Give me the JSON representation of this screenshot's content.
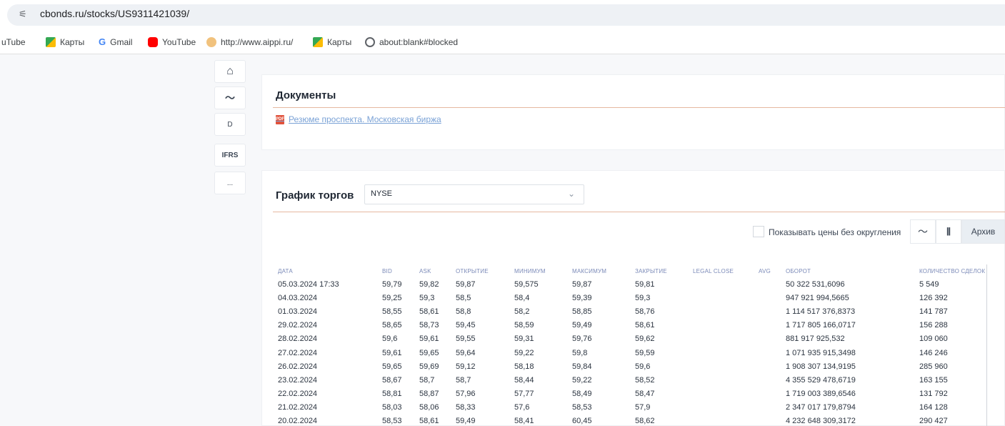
{
  "browser": {
    "url": "cbonds.ru/stocks/US9311421039/",
    "bookmarks": [
      "uTube",
      "Карты",
      "Gmail",
      "YouTube",
      "http://www.aippi.ru/",
      "Карты",
      "about:blank#blocked"
    ]
  },
  "sidebar": {
    "items": [
      "⌂",
      "〜",
      "D",
      "IFRS",
      "..."
    ]
  },
  "documents": {
    "title": "Документы",
    "link": "Резюме проспекта. Московская биржа",
    "pdf_badge": "PDF"
  },
  "trading": {
    "title": "График торгов",
    "exchange": "NYSE",
    "chevron": "⌄",
    "raw_prices_label": "Показывать цены без округления",
    "archive_label": "Архив"
  },
  "table": {
    "headers": [
      "ДАТА",
      "BID",
      "ASK",
      "ОТКРЫТИЕ",
      "МИНИМУМ",
      "МАКСИМУМ",
      "ЗАКРЫТИЕ",
      "LEGAL CLOSE",
      "AVG",
      "ОБОРОТ",
      "КОЛИЧЕСТВО СДЕЛОК"
    ],
    "rows": [
      [
        "05.03.2024 17:33",
        "59,79",
        "59,82",
        "59,87",
        "59,575",
        "59,87",
        "59,81",
        "",
        "",
        "50 322 531,6096",
        "5 549"
      ],
      [
        "04.03.2024",
        "59,25",
        "59,3",
        "58,5",
        "58,4",
        "59,39",
        "59,3",
        "",
        "",
        "947 921 994,5665",
        "126 392"
      ],
      [
        "01.03.2024",
        "58,55",
        "58,61",
        "58,8",
        "58,2",
        "58,85",
        "58,76",
        "",
        "",
        "1 114 517 376,8373",
        "141 787"
      ],
      [
        "29.02.2024",
        "58,65",
        "58,73",
        "59,45",
        "58,59",
        "59,49",
        "58,61",
        "",
        "",
        "1 717 805 166,0717",
        "156 288"
      ],
      [
        "28.02.2024",
        "59,6",
        "59,61",
        "59,55",
        "59,31",
        "59,76",
        "59,62",
        "",
        "",
        "881 917 925,532",
        "109 060"
      ],
      [
        "27.02.2024",
        "59,61",
        "59,65",
        "59,64",
        "59,22",
        "59,8",
        "59,59",
        "",
        "",
        "1 071 935 915,3498",
        "146 246"
      ],
      [
        "26.02.2024",
        "59,65",
        "59,69",
        "59,12",
        "58,18",
        "59,84",
        "59,6",
        "",
        "",
        "1 908 307 134,9195",
        "285 960"
      ],
      [
        "23.02.2024",
        "58,67",
        "58,7",
        "58,7",
        "58,44",
        "59,22",
        "58,52",
        "",
        "",
        "4 355 529 478,6719",
        "163 155"
      ],
      [
        "22.02.2024",
        "58,81",
        "58,87",
        "57,96",
        "57,77",
        "58,49",
        "58,47",
        "",
        "",
        "1 719 003 389,6546",
        "131 792"
      ],
      [
        "21.02.2024",
        "58,03",
        "58,06",
        "58,33",
        "57,6",
        "58,53",
        "57,9",
        "",
        "",
        "2 347 017 179,8794",
        "164 128"
      ],
      [
        "20.02.2024",
        "58,53",
        "58,61",
        "59,49",
        "58,41",
        "60,45",
        "58,62",
        "",
        "",
        "4 232 648 309,3172",
        "290 427"
      ]
    ]
  }
}
